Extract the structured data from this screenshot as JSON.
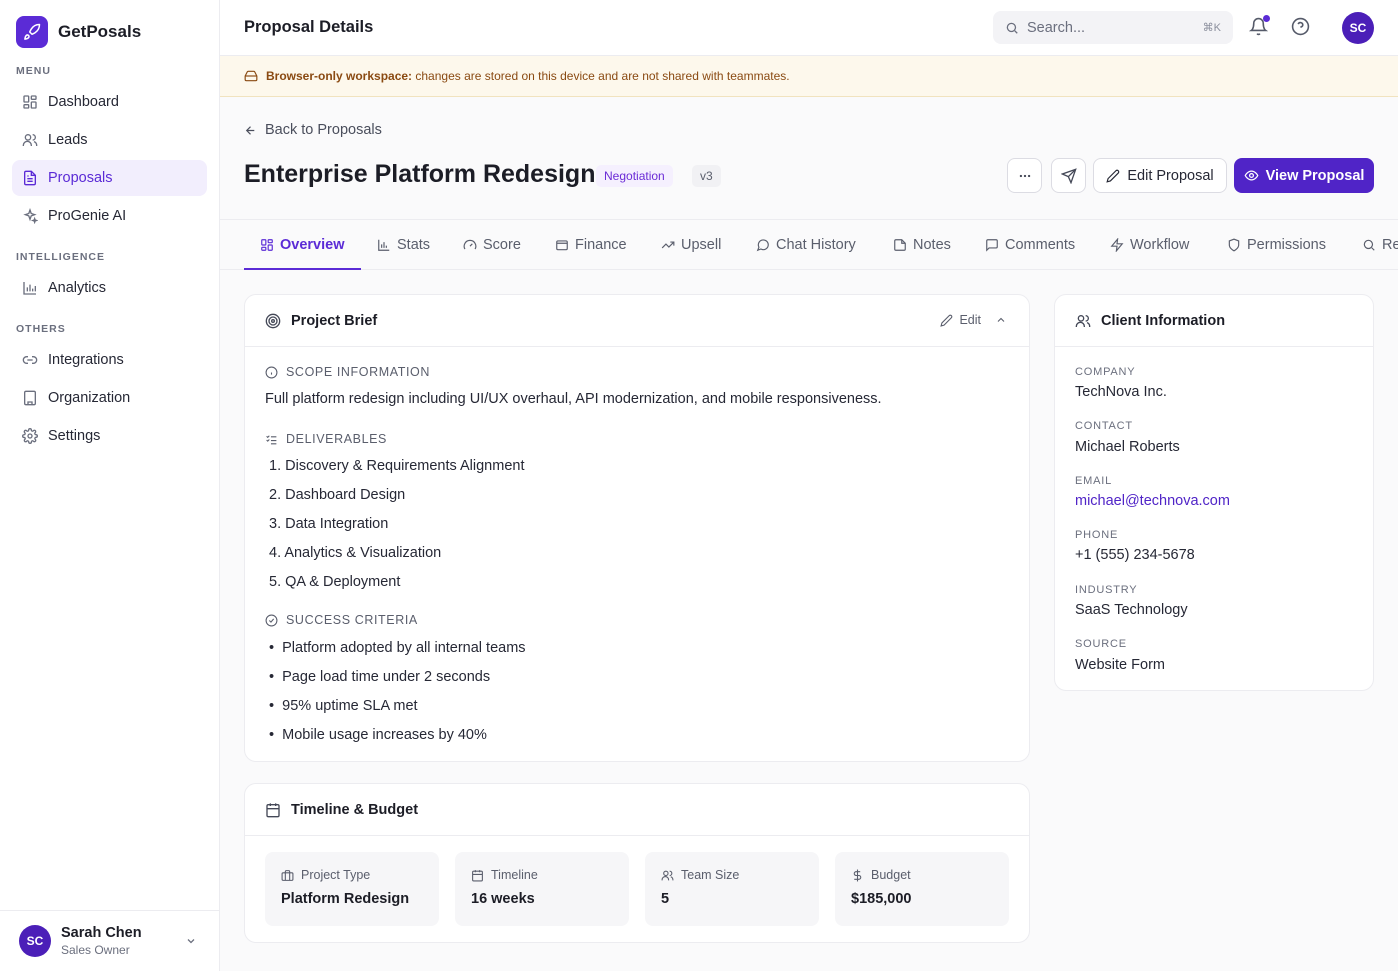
{
  "brand": {
    "name": "GetPosals"
  },
  "sidebar": {
    "sections": {
      "menu": "MENU",
      "intelligence": "INTELLIGENCE",
      "others": "OTHERS"
    },
    "items": [
      {
        "label": "Dashboard",
        "icon": "grid-icon"
      },
      {
        "label": "Leads",
        "icon": "users-icon"
      },
      {
        "label": "Proposals",
        "icon": "file-icon",
        "active": true
      },
      {
        "label": "ProGenie AI",
        "icon": "sparkles-icon"
      },
      {
        "label": "Analytics",
        "icon": "bar-chart-icon"
      },
      {
        "label": "Integrations",
        "icon": "link-icon"
      },
      {
        "label": "Organization",
        "icon": "building-icon"
      },
      {
        "label": "Settings",
        "icon": "gear-icon"
      }
    ],
    "user": {
      "initials": "SC",
      "name": "Sarah Chen",
      "role": "Sales Owner"
    }
  },
  "header": {
    "title": "Proposal Details",
    "search_placeholder": "Search...",
    "search_shortcut": "⌘K",
    "avatar_initials": "SC"
  },
  "banner": {
    "bold": "Browser-only workspace:",
    "text": " changes are stored on this device and are not shared with teammates."
  },
  "proposal": {
    "back_label": "Back to Proposals",
    "title": "Enterprise Platform Redesign",
    "status": "Negotiation",
    "version": "v3",
    "edit_label": "Edit Proposal",
    "view_label": "View Proposal"
  },
  "tabs": [
    {
      "label": "Overview",
      "active": true
    },
    {
      "label": "Stats"
    },
    {
      "label": "Score"
    },
    {
      "label": "Finance"
    },
    {
      "label": "Upsell"
    },
    {
      "label": "Chat History"
    },
    {
      "label": "Notes"
    },
    {
      "label": "Comments"
    },
    {
      "label": "Workflow"
    },
    {
      "label": "Permissions"
    },
    {
      "label": "Re"
    }
  ],
  "brief": {
    "title": "Project Brief",
    "edit_label": "Edit",
    "scope_label": "SCOPE INFORMATION",
    "scope_text": "Full platform redesign including UI/UX overhaul, API modernization, and mobile responsiveness.",
    "deliverables_label": "DELIVERABLES",
    "deliverables": [
      "1. Discovery & Requirements Alignment",
      "2. Dashboard Design",
      "3. Data Integration",
      "4. Analytics & Visualization",
      "5. QA & Deployment"
    ],
    "criteria_label": "SUCCESS CRITERIA",
    "criteria": [
      "Platform adopted by all internal teams",
      "Page load time under 2 seconds",
      "95% uptime SLA met",
      "Mobile usage increases by 40%"
    ]
  },
  "client": {
    "title": "Client Information",
    "fields": [
      {
        "label": "COMPANY",
        "value": "TechNova Inc."
      },
      {
        "label": "CONTACT",
        "value": "Michael Roberts"
      },
      {
        "label": "EMAIL",
        "value": "michael@technova.com"
      },
      {
        "label": "PHONE",
        "value": "+1 (555) 234-5678"
      },
      {
        "label": "INDUSTRY",
        "value": "SaaS Technology"
      },
      {
        "label": "SOURCE",
        "value": "Website Form"
      }
    ]
  },
  "timeline": {
    "title": "Timeline & Budget",
    "tiles": [
      {
        "label": "Project Type",
        "value": "Platform Redesign"
      },
      {
        "label": "Timeline",
        "value": "16 weeks"
      },
      {
        "label": "Team Size",
        "value": "5"
      },
      {
        "label": "Budget",
        "value": "$185,000"
      }
    ]
  },
  "colors": {
    "accent": "#5b2bd6",
    "banner_bg": "#fdf8ec",
    "banner_text": "#8a4a12"
  }
}
